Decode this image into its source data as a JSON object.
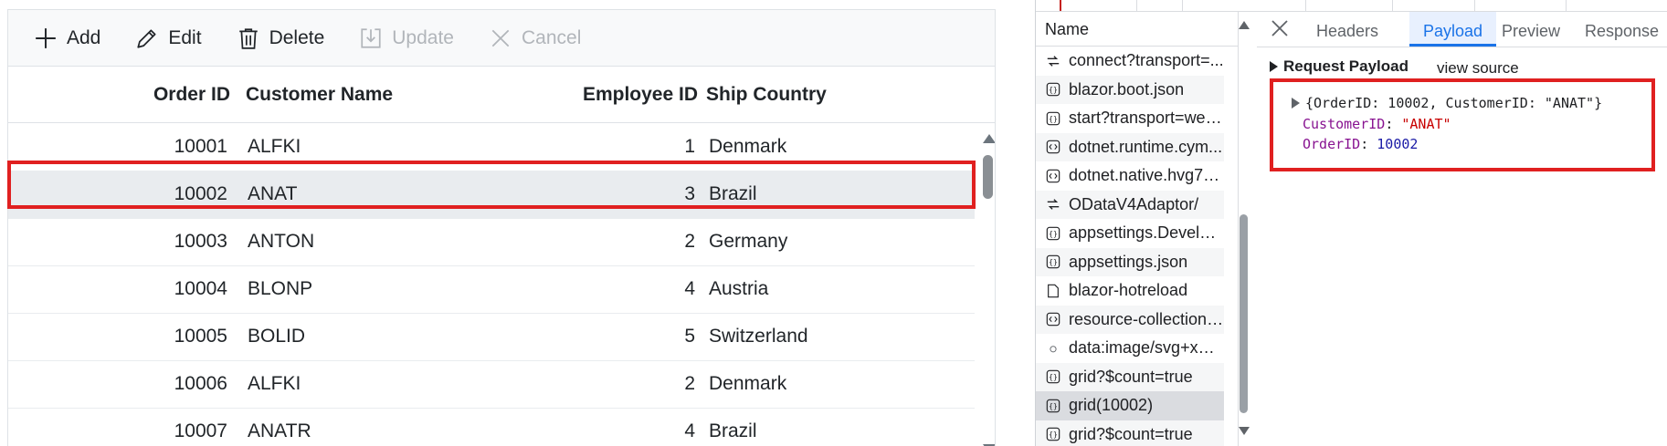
{
  "toolbar": {
    "add": "Add",
    "edit": "Edit",
    "delete": "Delete",
    "update": "Update",
    "cancel": "Cancel"
  },
  "grid": {
    "columns": [
      "Order ID",
      "Customer Name",
      "Employee ID",
      "Ship Country"
    ],
    "rows": [
      {
        "order_id": "10001",
        "customer": "ALFKI",
        "employee": "1",
        "country": "Denmark"
      },
      {
        "order_id": "10002",
        "customer": "ANAT",
        "employee": "3",
        "country": "Brazil"
      },
      {
        "order_id": "10003",
        "customer": "ANTON",
        "employee": "2",
        "country": "Germany"
      },
      {
        "order_id": "10004",
        "customer": "BLONP",
        "employee": "4",
        "country": "Austria"
      },
      {
        "order_id": "10005",
        "customer": "BOLID",
        "employee": "5",
        "country": "Switzerland"
      },
      {
        "order_id": "10006",
        "customer": "ALFKI",
        "employee": "2",
        "country": "Denmark"
      },
      {
        "order_id": "10007",
        "customer": "ANATR",
        "employee": "4",
        "country": "Brazil"
      }
    ],
    "selected_index": 1
  },
  "devtools": {
    "list_header": "Name",
    "requests": [
      {
        "name": "connect?transport=...",
        "icon": "websocket-icon"
      },
      {
        "name": "blazor.boot.json",
        "icon": "json-icon"
      },
      {
        "name": "start?transport=web...",
        "icon": "json-icon"
      },
      {
        "name": "dotnet.runtime.cym...",
        "icon": "script-icon"
      },
      {
        "name": "dotnet.native.hvg7u...",
        "icon": "script-icon"
      },
      {
        "name": "ODataV4Adaptor/",
        "icon": "websocket-icon"
      },
      {
        "name": "appsettings.Develop...",
        "icon": "json-icon"
      },
      {
        "name": "appsettings.json",
        "icon": "json-icon"
      },
      {
        "name": "blazor-hotreload",
        "icon": "document-icon"
      },
      {
        "name": "resource-collection....",
        "icon": "script-icon"
      },
      {
        "name": "data:image/svg+xml...",
        "icon": "image-icon"
      },
      {
        "name": "grid?$count=true",
        "icon": "json-icon"
      },
      {
        "name": "grid(10002)",
        "icon": "json-icon"
      },
      {
        "name": "grid?$count=true",
        "icon": "json-icon"
      }
    ],
    "active_request_index": 12,
    "tabs": [
      "Headers",
      "Payload",
      "Preview",
      "Response"
    ],
    "active_tab": "Payload",
    "payload_title": "Request Payload",
    "view_source": "view source",
    "payload_summary": "{OrderID: 10002, CustomerID: \"ANAT\"}",
    "payload_fields": [
      {
        "key": "CustomerID",
        "value": "\"ANAT\"",
        "type": "string"
      },
      {
        "key": "OrderID",
        "value": "10002",
        "type": "number"
      }
    ]
  }
}
